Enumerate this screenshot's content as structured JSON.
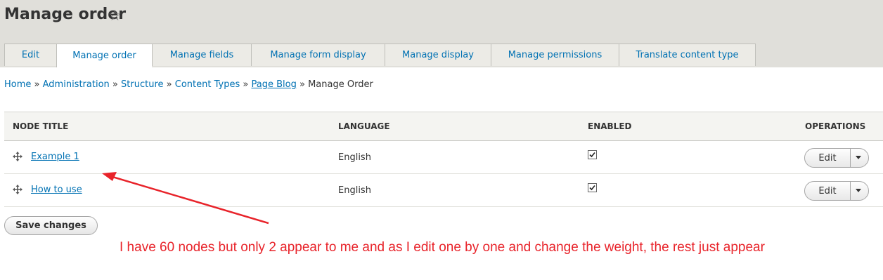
{
  "page": {
    "title": "Manage order",
    "star_icon": "star-outline-icon"
  },
  "tabs": [
    {
      "label": "Edit",
      "active": false
    },
    {
      "label": "Manage order",
      "active": true
    },
    {
      "label": "Manage fields",
      "active": false
    },
    {
      "label": "Manage form display",
      "active": false
    },
    {
      "label": "Manage display",
      "active": false
    },
    {
      "label": "Manage permissions",
      "active": false
    },
    {
      "label": "Translate content type",
      "active": false
    }
  ],
  "breadcrumb": {
    "items": [
      "Home",
      "Administration",
      "Structure",
      "Content Types",
      "Page Blog"
    ],
    "current": "Manage Order",
    "separator": "»"
  },
  "table": {
    "columns": [
      "NODE TITLE",
      "LANGUAGE",
      "ENABLED",
      "OPERATIONS"
    ],
    "rows": [
      {
        "title": "Example 1",
        "language": "English",
        "enabled": true,
        "operation": "Edit"
      },
      {
        "title": "How to use",
        "language": "English",
        "enabled": true,
        "operation": "Edit"
      }
    ]
  },
  "actions": {
    "save_label": "Save changes"
  },
  "annotation": {
    "text": "I have 60 nodes but only 2 appear to me and as I edit one by one and change the weight, the rest just appear",
    "color": "#e8232a"
  },
  "colors": {
    "link": "#0071b3",
    "header_bg": "#e0dfda"
  }
}
